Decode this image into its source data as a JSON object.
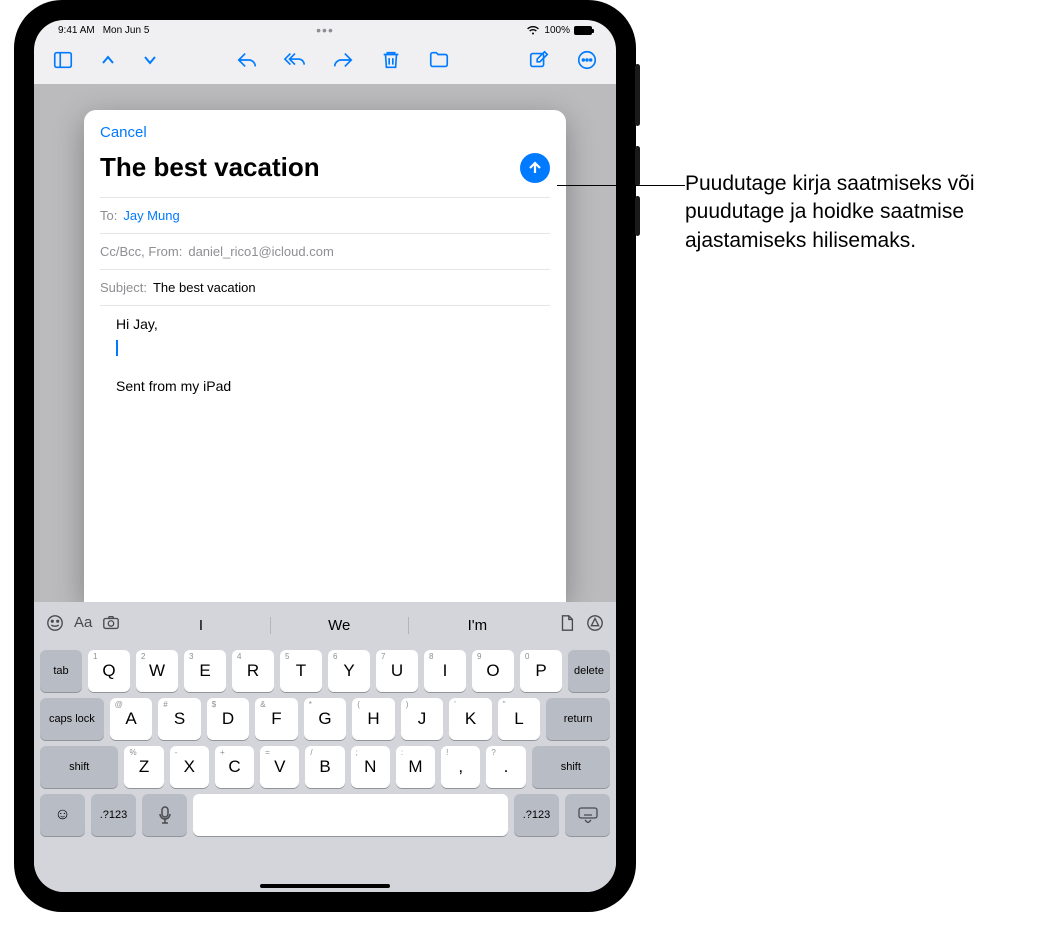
{
  "status": {
    "time": "9:41 AM",
    "date": "Mon Jun 5",
    "battery_text": "100%"
  },
  "toolbar": {
    "sidebar_icon": "sidebar",
    "up_icon": "chevron-up",
    "down_icon": "chevron-down",
    "reply_icon": "reply",
    "reply_all_icon": "reply-all",
    "forward_icon": "forward",
    "trash_icon": "trash",
    "folder_icon": "folder",
    "compose_icon": "compose",
    "more_icon": "more"
  },
  "compose": {
    "cancel": "Cancel",
    "title": "The best vacation",
    "to_label": "To:",
    "to_value": "Jay Mung",
    "ccbcc_label": "Cc/Bcc, From:",
    "from_value": "daniel_rico1@icloud.com",
    "subject_label": "Subject:",
    "subject_value": "The best vacation",
    "body_greeting": "Hi Jay,",
    "signature": "Sent from my iPad"
  },
  "keyboard": {
    "suggestions": [
      "I",
      "We",
      "I'm"
    ],
    "row1": [
      {
        "main": "Q",
        "hint": "1"
      },
      {
        "main": "W",
        "hint": "2"
      },
      {
        "main": "E",
        "hint": "3"
      },
      {
        "main": "R",
        "hint": "4"
      },
      {
        "main": "T",
        "hint": "5"
      },
      {
        "main": "Y",
        "hint": "6"
      },
      {
        "main": "U",
        "hint": "7"
      },
      {
        "main": "I",
        "hint": "8"
      },
      {
        "main": "O",
        "hint": "9"
      },
      {
        "main": "P",
        "hint": "0"
      }
    ],
    "tab": "tab",
    "delete": "delete",
    "row2": [
      {
        "main": "A",
        "hint": "@"
      },
      {
        "main": "S",
        "hint": "#"
      },
      {
        "main": "D",
        "hint": "$"
      },
      {
        "main": "F",
        "hint": "&"
      },
      {
        "main": "G",
        "hint": "*"
      },
      {
        "main": "H",
        "hint": "("
      },
      {
        "main": "J",
        "hint": ")"
      },
      {
        "main": "K",
        "hint": "'"
      },
      {
        "main": "L",
        "hint": "\""
      }
    ],
    "caps": "caps lock",
    "return": "return",
    "row3": [
      {
        "main": "Z",
        "hint": "%"
      },
      {
        "main": "X",
        "hint": "-"
      },
      {
        "main": "C",
        "hint": "+"
      },
      {
        "main": "V",
        "hint": "="
      },
      {
        "main": "B",
        "hint": "/"
      },
      {
        "main": "N",
        "hint": ";"
      },
      {
        "main": "M",
        "hint": ":"
      },
      {
        "main": ",",
        "hint": "!"
      },
      {
        "main": ".",
        "hint": "?"
      }
    ],
    "shift": "shift",
    "numkey": ".?123"
  },
  "callout": "Puudutage kirja saatmiseks või puudutage ja hoidke saatmise ajastamiseks hilisemaks."
}
